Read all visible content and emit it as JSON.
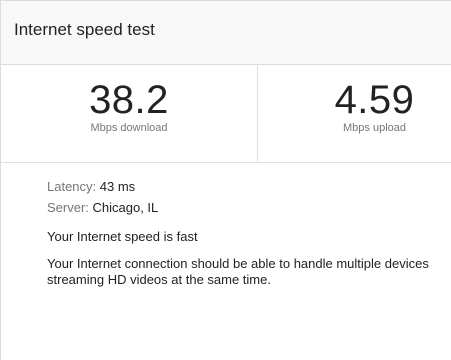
{
  "header": {
    "title": "Internet speed test"
  },
  "results": {
    "download": {
      "value": "38.2",
      "label": "Mbps download"
    },
    "upload": {
      "value": "4.59",
      "label": "Mbps upload"
    }
  },
  "details": {
    "latency_label": "Latency: ",
    "latency_value": "43 ms",
    "server_label": "Server: ",
    "server_value": "Chicago, IL"
  },
  "summary": {
    "headline": "Your Internet speed is fast",
    "description": "Your Internet connection should be able to handle multiple devices streaming HD videos at the same time."
  }
}
